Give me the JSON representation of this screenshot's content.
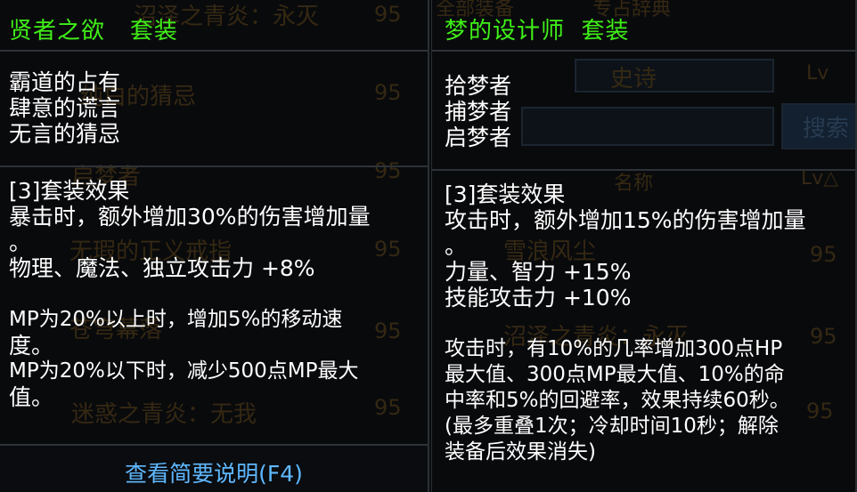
{
  "left_panel": {
    "set_name": "贤者之欲",
    "set_label": "套装",
    "items": [
      "霸道的占有",
      "肆意的谎言",
      "无言的猜忌"
    ],
    "effect_header": "[3]套装效果",
    "effect_lines": [
      "暴击时，额外增加30%的伤害增加量",
      "。",
      "物理、魔法、独立攻击力 +8%",
      "",
      "MP为20%以上时，增加5%的移动速",
      "度。",
      "MP为20%以下时，减少500点MP最大",
      "值。"
    ],
    "footer_link": "查看简要说明(F4)"
  },
  "right_panel": {
    "set_name": "梦的设计师",
    "set_label": "套装",
    "items": [
      "拾梦者",
      "捕梦者",
      "启梦者"
    ],
    "effect_header": "[3]套装效果",
    "effect_lines": [
      "攻击时，额外增加15%的伤害增加量",
      "。",
      "力量、智力 +15%",
      "技能攻击力 +10%",
      "",
      "攻击时，有10%的几率增加300点HP",
      "最大值、300点MP最大值、10%的命",
      "中率和5%的回避率，效果持续60秒。",
      "(最多重叠1次；冷却时间10秒；解除",
      "装备后效果消失)"
    ]
  },
  "background": {
    "left_items": [
      "沼泽之青炎：永灭",
      "纯白的猜忌",
      "启梦者",
      "无瑕的正义戒指",
      "苍穹幕落",
      "迷惑之青炎：无我"
    ],
    "left_levels": [
      "95",
      "95",
      "95",
      "95",
      "95",
      "95"
    ],
    "right_tabs": [
      "全部装备",
      "专占辞典"
    ],
    "right_filter_rarity": "史诗",
    "right_level_label": "Lv",
    "right_search_button": "搜索",
    "right_header_name": "名称",
    "right_header_lv": "Lv△",
    "right_items": [
      "雪浪风尘",
      "沼泽之青炎：永灭"
    ],
    "right_levels": [
      "95",
      "95",
      "95"
    ]
  }
}
